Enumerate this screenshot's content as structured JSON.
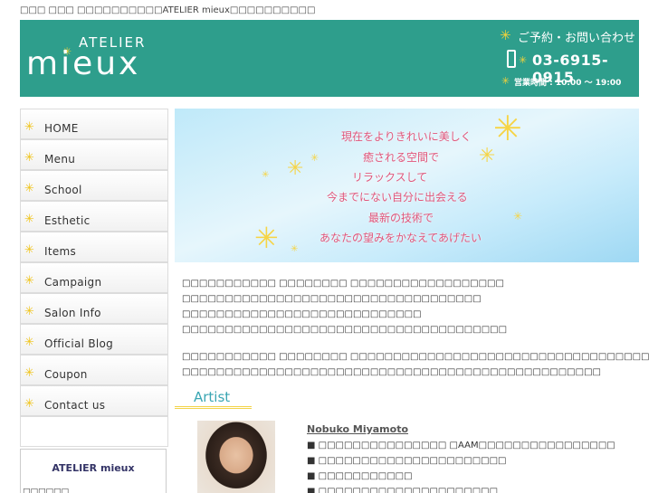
{
  "topline": "□□□ □□□ □□□□□□□□□□ATELIER mieux□□□□□□□□□□",
  "header": {
    "logo_top": "ATELIER",
    "logo_bottom": "mieux",
    "contact_label": "ご予約・お問い合わせ",
    "phone": "03-6915-0915",
    "hours": "営業時間 : 10:00 〜 19:00"
  },
  "nav": {
    "items": [
      {
        "label": "HOME"
      },
      {
        "label": "Menu"
      },
      {
        "label": "School"
      },
      {
        "label": "Esthetic"
      },
      {
        "label": "Items"
      },
      {
        "label": "Campaign"
      },
      {
        "label": "Salon Info"
      },
      {
        "label": "Official Blog"
      },
      {
        "label": "Coupon"
      },
      {
        "label": "Contact us"
      }
    ]
  },
  "shop": {
    "title": "ATELIER mieux",
    "sub": "□□□□□□"
  },
  "banner": {
    "lines": [
      "現在をよりきれいに美しく",
      "癒される空間で",
      "リラックスして",
      "今までにない自分に出会える",
      "最新の技術で",
      "あなたの望みをかなえてあげたい"
    ]
  },
  "intro": {
    "p1": [
      "□□□□□□□□□□□ □□□□□□□□ □□□□□□□□□□□□□□□□□□",
      "□□□□□□□□□□□□□□□□□□□□□□□□□□□□□□□□□□□",
      "□□□□□□□□□□□□□□□□□□□□□□□□□□□□",
      "□□□□□□□□□□□□□□□□□□□□□□□□□□□□□□□□□□□□□□"
    ],
    "p2": [
      "□□□□□□□□□□□ □□□□□□□□ □□□□□□□□□□□□□□□□□□□□□□□□□□□□□□□□□□□",
      "□□□□□□□□□□□□□□□□□□□□□□□□□□□□□□□□□□□□□□□□□□□□□□□□□"
    ]
  },
  "artist": {
    "heading": "Artist",
    "name": "Nobuko Miyamoto",
    "items": [
      "■ □□□□□□□□□□□□□□□ □AAM□□□□□□□□□□□□□□□□",
      "■ □□□□□□□□□□□□□□□□□□□□□□",
      "■ □□□□□□□□□□□",
      "■ □□□□□□□□□□□□□□□□□□□□□"
    ]
  }
}
